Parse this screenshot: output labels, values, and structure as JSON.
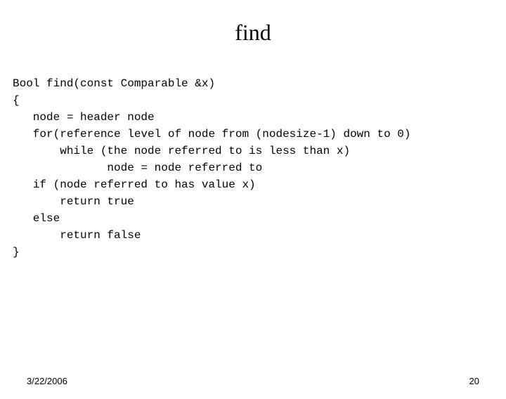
{
  "title": "find",
  "code": {
    "l1": "Bool find(const Comparable &x)",
    "l2": "{",
    "l3": "   node = header node",
    "l4": "   for(reference level of node from (nodesize-1) down to 0)",
    "l5": "       while (the node referred to is less than x)",
    "l6": "              node = node referred to",
    "l7": "   if (node referred to has value x)",
    "l8": "       return true",
    "l9": "   else",
    "l10": "       return false",
    "l11": "}"
  },
  "footer": {
    "date": "3/22/2006",
    "page": "20"
  }
}
